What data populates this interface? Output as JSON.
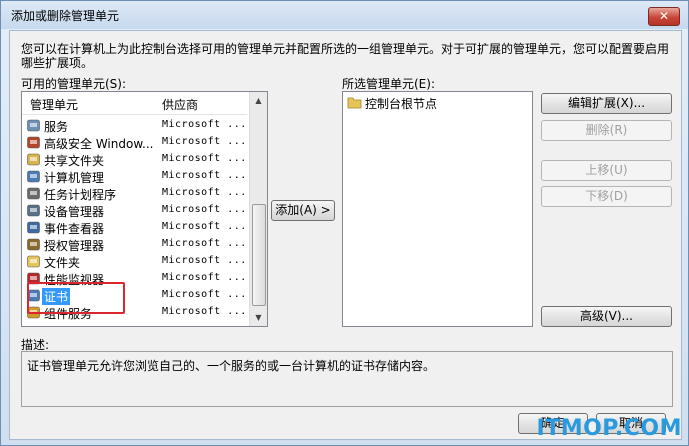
{
  "window": {
    "title": "添加或删除管理单元",
    "close_label": "✕"
  },
  "intro_text": "您可以在计算机上为此控制台选择可用的管理单元并配置所选的一组管理单元。对于可扩展的管理单元，您可以配置要启用哪些扩展项。",
  "available": {
    "label": "可用的管理单元(S):",
    "col_name": "管理单元",
    "col_vendor": "供应商",
    "items": [
      {
        "name": "服务",
        "vendor": "Microsoft ...",
        "icon": "services-gear-icon",
        "color": "#6d8fb8"
      },
      {
        "name": "高级安全 Window...",
        "vendor": "Microsoft ...",
        "icon": "firewall-icon",
        "color": "#b3472a"
      },
      {
        "name": "共享文件夹",
        "vendor": "Microsoft ...",
        "icon": "shared-folder-icon",
        "color": "#d8b24a"
      },
      {
        "name": "计算机管理",
        "vendor": "Microsoft ...",
        "icon": "computer-management-icon",
        "color": "#4a7bb6"
      },
      {
        "name": "任务计划程序",
        "vendor": "Microsoft ...",
        "icon": "task-scheduler-icon",
        "color": "#6a6a6a"
      },
      {
        "name": "设备管理器",
        "vendor": "Microsoft ...",
        "icon": "device-manager-icon",
        "color": "#5a6f88"
      },
      {
        "name": "事件查看器",
        "vendor": "Microsoft ...",
        "icon": "event-viewer-icon",
        "color": "#3d6aa3"
      },
      {
        "name": "授权管理器",
        "vendor": "Microsoft ...",
        "icon": "authorization-manager-icon",
        "color": "#8a6a2a"
      },
      {
        "name": "文件夹",
        "vendor": "Microsoft ...",
        "icon": "folder-icon",
        "color": "#e6c45a"
      },
      {
        "name": "性能监视器",
        "vendor": "Microsoft ...",
        "icon": "performance-monitor-icon",
        "color": "#b32a2a"
      },
      {
        "name": "证书",
        "vendor": "Microsoft ...",
        "icon": "certificate-icon",
        "color": "#4a7bb6",
        "selected": true
      },
      {
        "name": "组件服务",
        "vendor": "Microsoft ...",
        "icon": "component-services-icon",
        "color": "#d29a2a"
      }
    ]
  },
  "add_button": "添加(A) >",
  "selected": {
    "label": "所选管理单元(E):",
    "items": [
      {
        "name": "控制台根节点",
        "icon": "folder-icon"
      }
    ]
  },
  "buttons": {
    "edit_extensions": "编辑扩展(X)...",
    "remove": "删除(R)",
    "move_up": "上移(U)",
    "move_down": "下移(D)",
    "advanced": "高级(V)...",
    "ok": "确定",
    "cancel": "取消"
  },
  "description": {
    "label": "描述:",
    "text": "证书管理单元允许您浏览自己的、一个服务的或一台计算机的证书存储内容。"
  },
  "watermark": "ITMOP.COM"
}
